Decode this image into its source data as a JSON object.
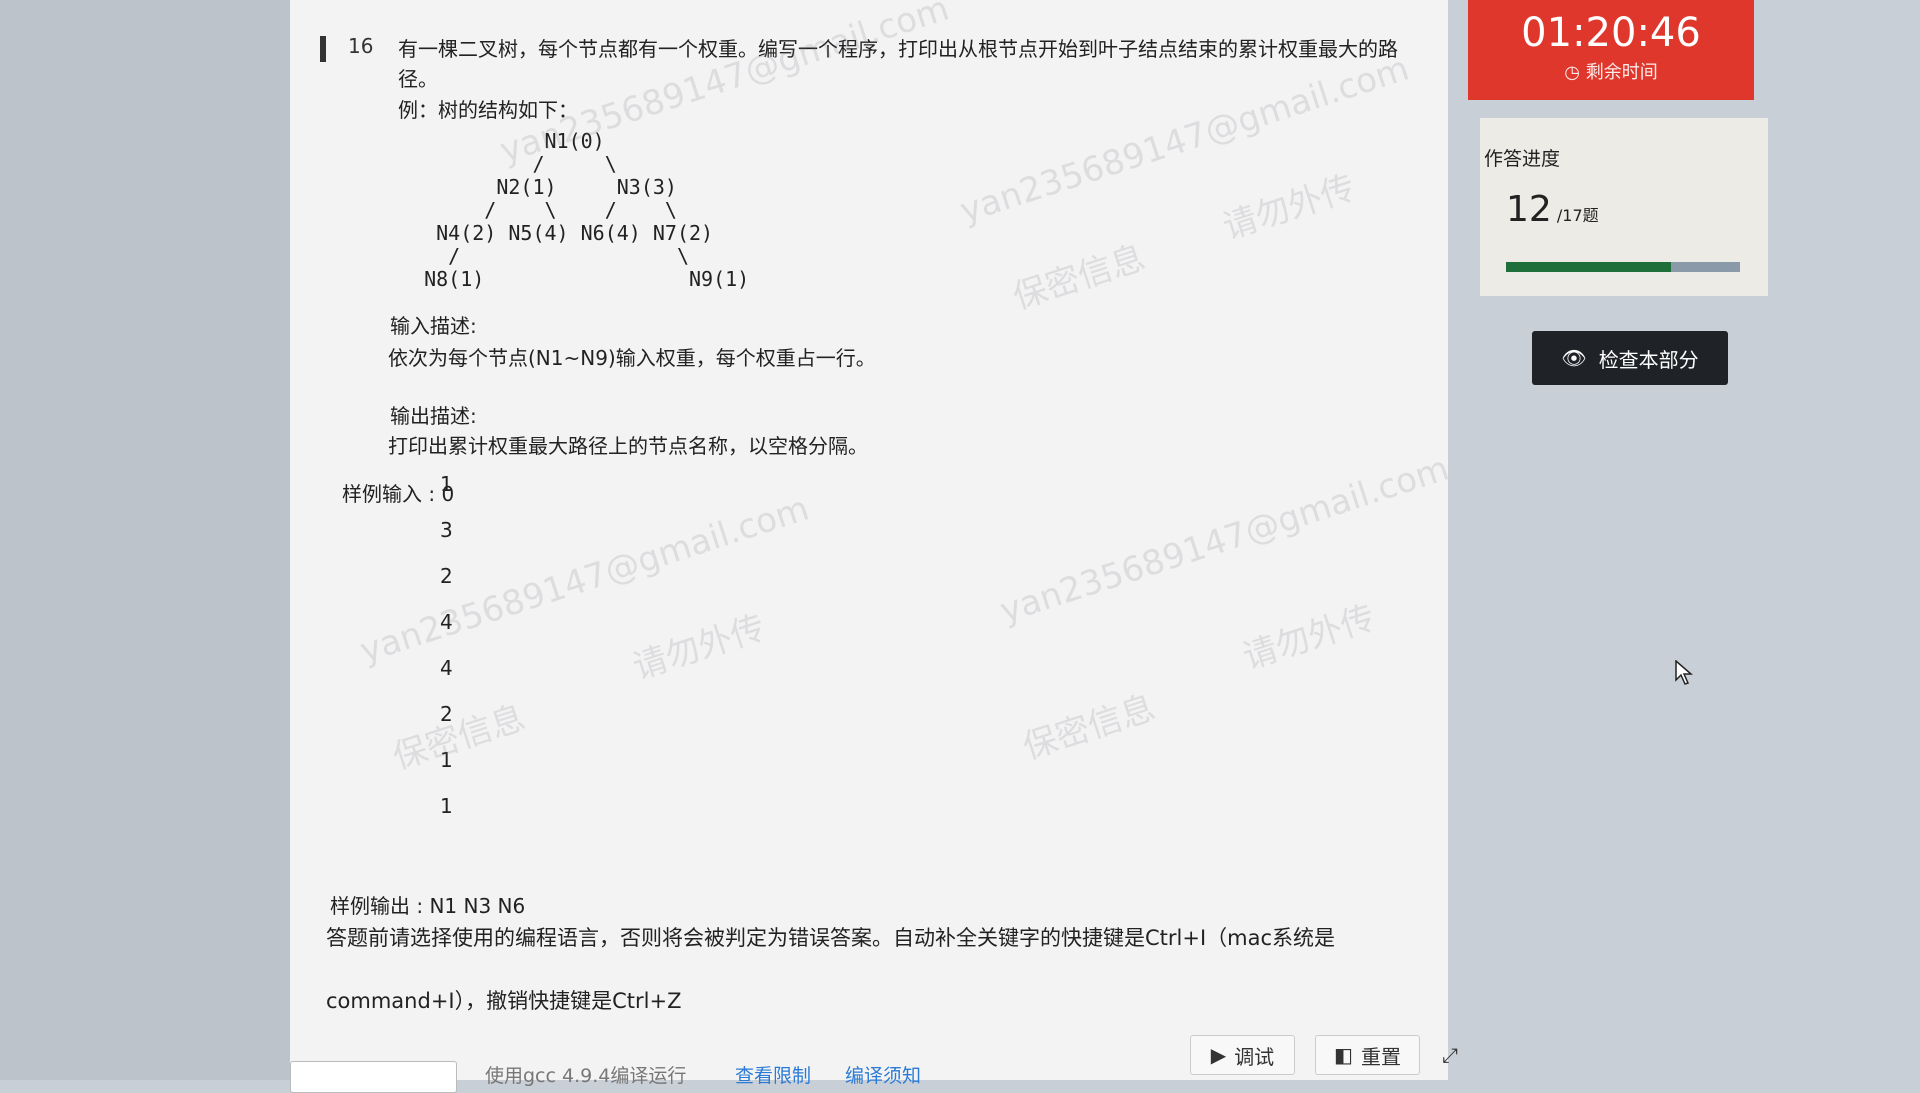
{
  "question": {
    "number": "16",
    "text": "有一棵二叉树，每个节点都有一个权重。编写一个程序，打印出从根节点开始到叶子结点结束的累计权重最大的路径。",
    "example_label": "例：树的结构如下：",
    "tree_lines": [
      "            N1(0)",
      "           /     \\",
      "        N2(1)     N3(3)",
      "       /    \\    /    \\",
      "   N4(2) N5(4) N6(4) N7(2)",
      "    /                  \\",
      "  N8(1)                 N9(1)"
    ],
    "input_title": "输入描述:",
    "input_body": "依次为每个节点(N1~N9)输入权重，每个权重占一行。",
    "output_title": "输出描述:",
    "output_body": "打印出累计权重最大路径上的节点名称，以空格分隔。",
    "sample_input_label": "样例输入 : 0",
    "sample_input_rest": [
      "1",
      "3",
      "2",
      "4",
      "4",
      "2",
      "1",
      "1"
    ],
    "sample_output_label": "样例输出 : N1 N3 N6",
    "note_line1": "答题前请选择使用的编程语言，否则将会被判定为错误答案。自动补全关键字的快捷键是Ctrl+I（mac系统是",
    "note_line2": "command+I），撤销快捷键是Ctrl+Z"
  },
  "bottom": {
    "compile_info": "使用gcc 4.9.4编译运行",
    "link_limits": "查看限制",
    "link_notice": "编译须知",
    "debug_label": "调试",
    "reset_label": "重置"
  },
  "timer": {
    "time": "01:20:46",
    "label": "剩余时间"
  },
  "progress": {
    "title": "作答进度",
    "current": "12",
    "total_label": "/17题",
    "fraction": 0.705
  },
  "check_button_label": "检查本部分",
  "watermarks": {
    "email": "yan235689147@gmail.com",
    "confidential": "保密信息",
    "no_share": "请勿外传"
  },
  "colors": {
    "timer_bg": "#e0372c",
    "progress_fill": "#1e6f3a",
    "link": "#2b7bd6"
  }
}
